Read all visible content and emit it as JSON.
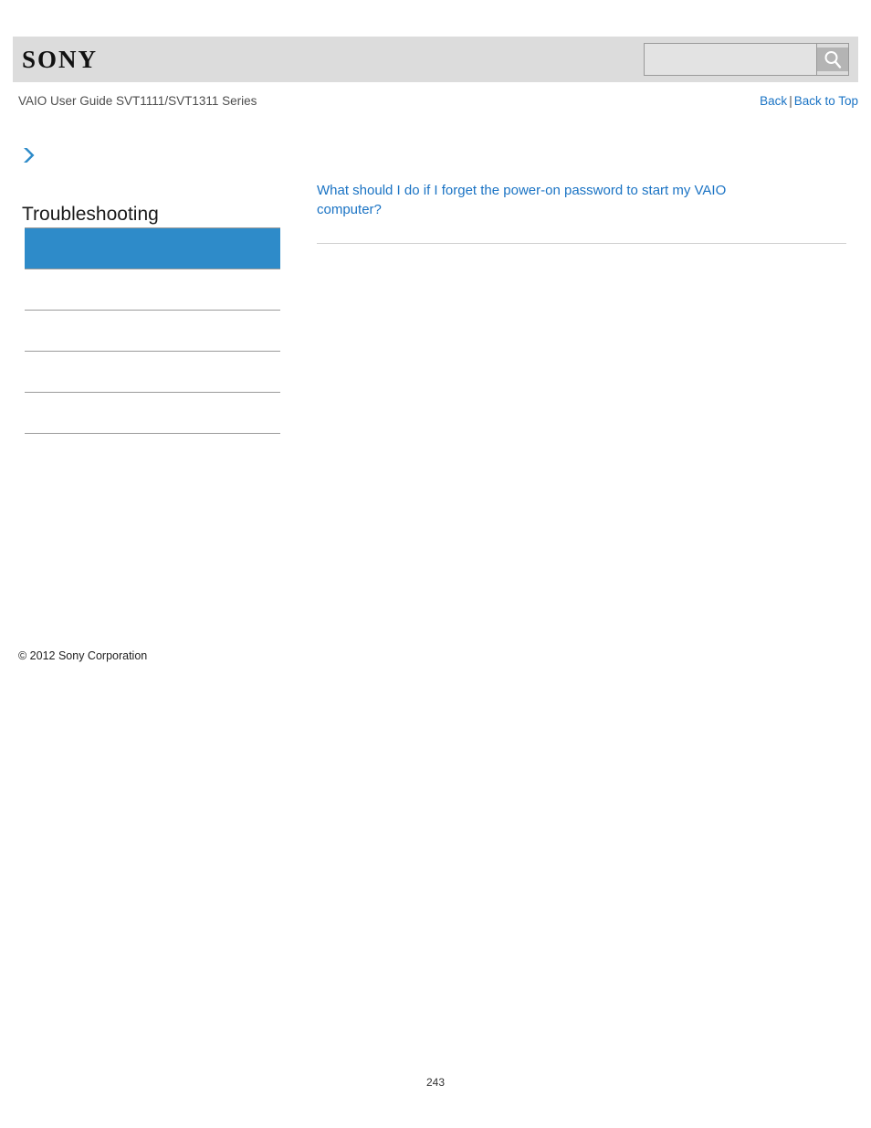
{
  "header": {
    "logo_text": "SONY",
    "guide_title": "VAIO User Guide SVT1111/SVT1311 Series",
    "nav": {
      "back_label": "Back",
      "separator": "|",
      "back_to_top_label": "Back to Top"
    },
    "search": {
      "value": "",
      "placeholder": "",
      "button_icon": "search-icon"
    }
  },
  "sidebar": {
    "arrow_icon": "chevron-right-icon",
    "title": "Troubleshooting",
    "accent_color": "#2e8bc9",
    "items": [
      {
        "label": "",
        "selected": true
      },
      {
        "label": "",
        "selected": false
      },
      {
        "label": "",
        "selected": false
      },
      {
        "label": "",
        "selected": false
      },
      {
        "label": "",
        "selected": false
      },
      {
        "label": "",
        "selected": false
      }
    ],
    "copyright": "© 2012 Sony Corporation"
  },
  "main": {
    "link_text": "What should I do if I forget the power-on password to start my VAIO computer?",
    "link_color": "#1a73c4"
  },
  "footer": {
    "page_number": "243"
  }
}
